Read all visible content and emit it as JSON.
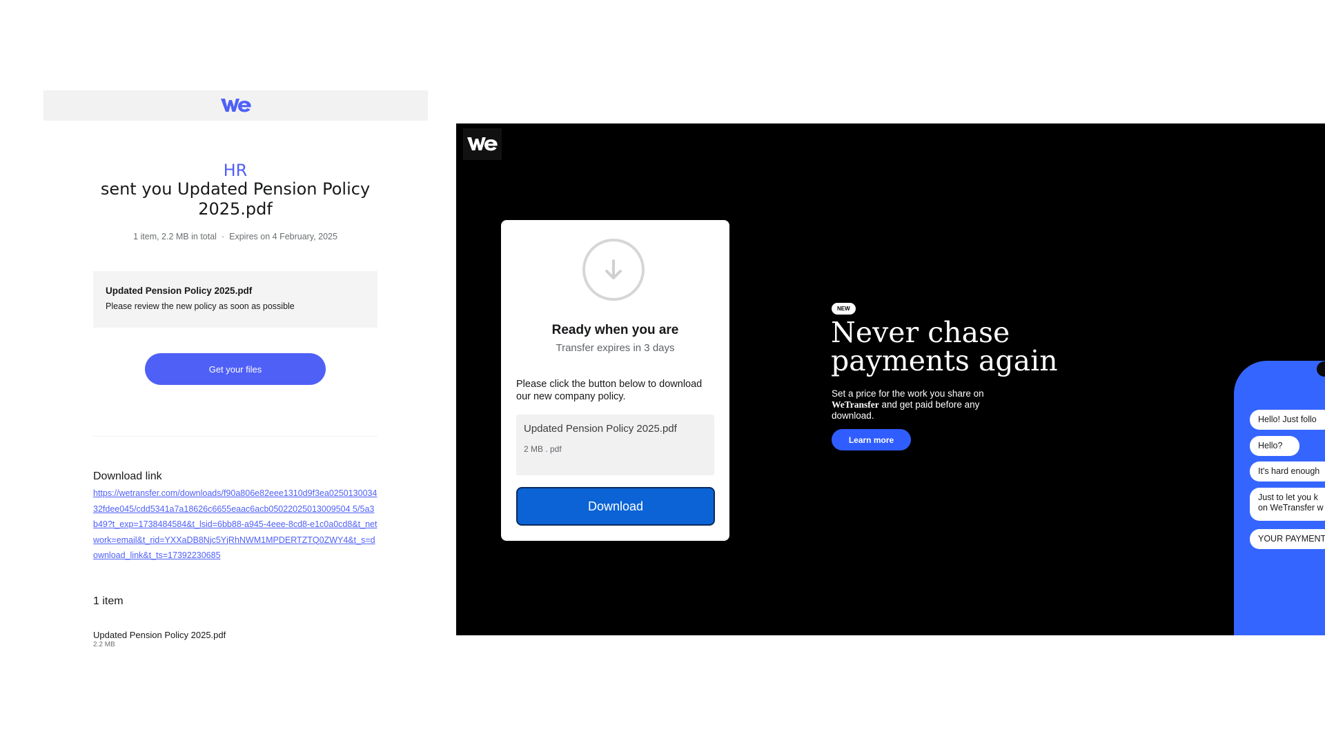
{
  "email": {
    "sender": "HR",
    "headline": "sent you Updated Pension Policy 2025.pdf",
    "meta_count": "1 item, 2.2 MB in total",
    "meta_separator": "·",
    "meta_expires": "Expires on 4 February, 2025",
    "file_box": {
      "name": "Updated Pension Policy 2025.pdf",
      "message": "Please review the new policy as soon as possible"
    },
    "get_files_label": "Get your files",
    "download_link_title": "Download link",
    "download_link_url": "https://wetransfer.com/downloads/f90a806e82eee1310d9f3ea025013003432fdee045/cdd5341a7a18626c6655eaac6acb05022025013009504 5/5a3b49?t_exp=1738484584&t_lsid=6bb88-a945-4eee-8cd8-e1c0a0cd8&t_network=email&t_rid=YXXaDB8Njc5YjRhNWM1MPDERTZTQ0ZWY4&t_s=download_link&t_ts=17392230685",
    "items_title": "1 item",
    "item_name": "Updated Pension Policy 2025.pdf",
    "item_size": "2.2 MB",
    "accent_color": "#4f60f7",
    "logo_icon": "wetransfer-logo-icon"
  },
  "download_page": {
    "logo_icon": "wetransfer-logo-icon",
    "card": {
      "icon": "download-arrow-icon",
      "title": "Ready when you are",
      "expires": "Transfer expires in 3 days",
      "message": "Please click the button below to download our new company policy.",
      "file_name": "Updated Pension Policy 2025.pdf",
      "file_meta": "2 MB . pdf",
      "download_label": "Download",
      "button_color": "#0b63d6"
    },
    "ad": {
      "badge": "NEW",
      "title": "Never chase payments again",
      "subtitle_pre": "Set a price for the work you share on ",
      "subtitle_brand": "WeTransfer",
      "subtitle_post": " and get paid before any download.",
      "learn_more_label": "Learn more",
      "accent_color": "#2f5dff"
    },
    "phone_bubbles": [
      "Hello! Just follo",
      "Hello?",
      "It's hard enough",
      "Just to let you k",
      "on WeTransfer w",
      "YOUR PAYMENT"
    ]
  }
}
